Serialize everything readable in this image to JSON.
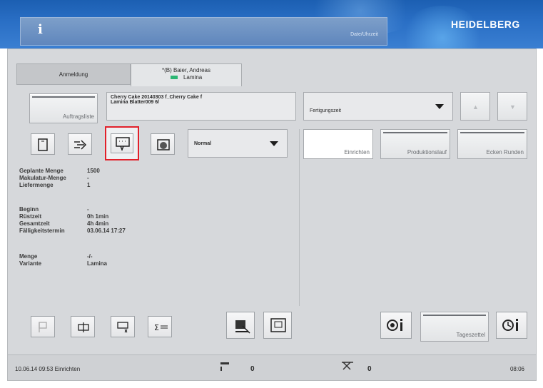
{
  "header": {
    "info_label": "i",
    "info_text": "Date/Uhrzeit",
    "brand": "HEIDELBERG"
  },
  "tabs": [
    {
      "label": "Anmeldung"
    },
    {
      "label": "*(B) Baier, Andreas",
      "sub_label": "Lamina",
      "indicator_color": "#2bb673"
    }
  ],
  "job": {
    "slot_label": "Auftragsliste",
    "line1": "Cherry Cake 20140303 f_Cherry Cake f",
    "line2": "Lamina Blatter009 6/"
  },
  "right_top": {
    "dropdown_label": "Fertigungszeit",
    "up_icon": "chevron-up-icon",
    "down_icon": "chevron-down-icon"
  },
  "mode_dropdown": {
    "value": "Normal"
  },
  "phase_buttons": [
    "Einrichten",
    "Produktionslauf",
    "Ecken Runden"
  ],
  "details": {
    "group1": [
      {
        "key": "Geplante Menge",
        "value": "1500"
      },
      {
        "key": "Makulatur-Menge",
        "value": "-"
      },
      {
        "key": "Liefermenge",
        "value": "1"
      }
    ],
    "group2": [
      {
        "key": "Beginn",
        "value": "-"
      },
      {
        "key": "Rüstzeit",
        "value": "0h 1min"
      },
      {
        "key": "Gesamtzeit",
        "value": "4h 4min"
      },
      {
        "key": "Fälligkeitstermin",
        "value": "03.06.14 17:27"
      }
    ],
    "group3": [
      {
        "key": "Menge",
        "value": "-/-"
      },
      {
        "key": "Variante",
        "value": "Lamina"
      }
    ]
  },
  "bottom": {
    "tageszettel_label": "Tageszettel"
  },
  "status": {
    "left_text": "10.06.14 09:53 Einrichten",
    "counter1": "0",
    "counter2": "0",
    "right_text": "08:06"
  },
  "colors": {
    "highlight": "#e2202a",
    "header_blue": "#2a6fc5"
  }
}
